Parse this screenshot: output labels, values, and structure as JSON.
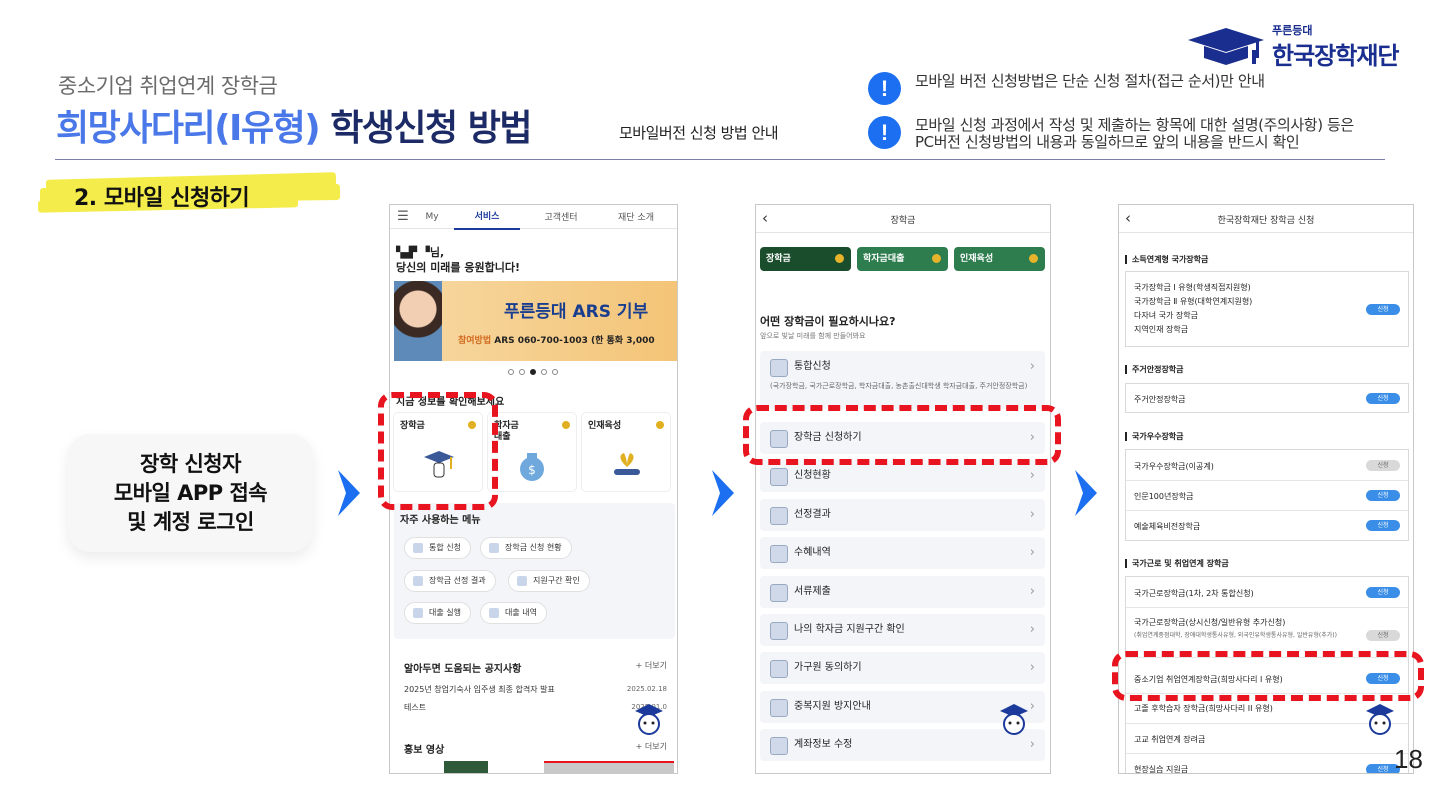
{
  "header": {
    "subtitle": "중소기업 취업연계 장학금",
    "title_blue": "희망사다리(I유형)",
    "title_dark": " 학생신청 방법",
    "note": "모바일버전 신청 방법 안내",
    "notices": [
      "모바일 버전 신청방법은 단순 신청 절차(접근 순서)만 안내",
      "모바일 신청 과정에서 작성 및 제출하는 항목에 대한 설명(주의사항) 등은",
      "PC버전 신청방법의 내용과 동일하므로 앞의 내용을 반드시 확인"
    ],
    "notice_icon": "!"
  },
  "logo": {
    "small": "푸른등대",
    "big": "한국장학재단"
  },
  "section_tag": "2. 모바일 신청하기",
  "callout": {
    "line1": "장학 신청자",
    "line2": "모바일 APP 접속",
    "line3": "및 계정 로그인"
  },
  "phone1": {
    "menu_icon": "☰",
    "tabs": [
      "My",
      "서비스",
      "고객센터",
      "재단 소개"
    ],
    "greet1": "▚▟▘▝님,",
    "greet2": "당신의 미래를 응원합니다!",
    "banner_title": "푸른등대 ARS 기부",
    "banner_label": "참여방법",
    "banner_text": " ARS 060-700-1003 (한 통화 3,000",
    "section1": "지금 정보를 확인해보세요",
    "cards": [
      "장학금",
      "학자금\n대출",
      "인재육성"
    ],
    "section2": "자주 사용하는 메뉴",
    "chips": [
      "통합 신청",
      "장학금 신청 현황",
      "장학금 선정 결과",
      "지원구간 확인",
      "대출 실행",
      "대출 내역"
    ],
    "notice_title": "알아두면 도움되는 공지사항",
    "more": "+ 더보기",
    "notices": [
      {
        "text": "2025년 창업기숙사 입주생 최종 합격자 발표",
        "date": "2025.02.18"
      },
      {
        "text": "테스트",
        "date": "2025.01.0"
      }
    ],
    "promo_title": "홍보 영상"
  },
  "phone2": {
    "back": "‹",
    "title": "장학금",
    "tabs": [
      "장학금",
      "학자금대출",
      "인재육성"
    ],
    "question": "어떤 장학금이 필요하시나요?",
    "question_sub": "앞으로 빛날 미래를 함께 만들어봐요",
    "rows": [
      {
        "label": "통합신청",
        "sub": "(국가장학금, 국가근로장학금, 학자금대출, 농촌출신대학생 학자금대출, 주거안정장학금)"
      },
      {
        "label": "장학금 신청하기"
      },
      {
        "label": "신청현황"
      },
      {
        "label": "선정결과"
      },
      {
        "label": "수혜내역"
      },
      {
        "label": "서류제출"
      },
      {
        "label": "나의 학자금 지원구간 확인"
      },
      {
        "label": "가구원 동의하기"
      },
      {
        "label": "중복지원 방지안내"
      },
      {
        "label": "계좌정보 수정"
      }
    ]
  },
  "phone3": {
    "back": "‹",
    "title": "한국장학재단 장학금 신청",
    "badge_on": "신청",
    "badge_off": "신청",
    "cat1": "소득연계형 국가장학금",
    "cat1_items": [
      "국가장학금 Ⅰ 유형(학생직접지원형)",
      "국가장학금 Ⅱ 유형(대학연계지원형)",
      "다자녀 국가 장학금",
      "지역인재 장학금"
    ],
    "cat2": "주거안정장학금",
    "cat2_items": [
      "주거안정장학금"
    ],
    "cat3": "국가우수장학금",
    "cat3_items": [
      "국가우수장학금(이공계)",
      "인문100년장학금",
      "예술체육비전장학금"
    ],
    "cat4": "국가근로 및 취업연계 장학금",
    "cat4_items": [
      "국가근로장학금(1차, 2차 통합신청)",
      "국가근로장학금(상시신청/일반유형 추가신청)",
      "중소기업 취업연계장학금(희망사다리 I 유형)",
      "고졸 후학습자 장학금(희망사다리 II 유형)",
      "고교 취업연계 장려금",
      "현장실습 지원금"
    ],
    "cat4_sub": "(취업연계중점대학, 장애대학생통사유형, 외국인유학생통사유형, 일반유형(추가))"
  },
  "page_number": "18",
  "colors": {
    "accent_blue": "#4a78e8",
    "navy": "#1c2a66",
    "highlight_red": "#e8141f",
    "arrow_blue": "#1b6ff0",
    "tag_yellow": "#f4ec4a"
  }
}
